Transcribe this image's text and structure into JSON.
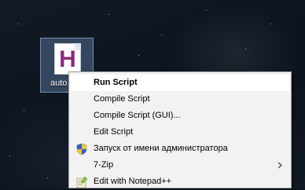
{
  "desktop": {
    "file_icon": {
      "glyph": "H",
      "label": "auto",
      "icon": "autohotkey-file-icon"
    }
  },
  "context_menu": {
    "items": [
      {
        "label": "Run Script"
      },
      {
        "label": "Compile Script"
      },
      {
        "label": "Compile Script (GUI)..."
      },
      {
        "label": "Edit Script"
      },
      {
        "label": "Запуск от имени администратора",
        "icon": "uac-shield-icon"
      },
      {
        "label": "7-Zip",
        "icon": "chevron-right-icon"
      },
      {
        "label": "Edit with Notepad++",
        "icon": "notepad-plus-plus-icon"
      }
    ]
  }
}
